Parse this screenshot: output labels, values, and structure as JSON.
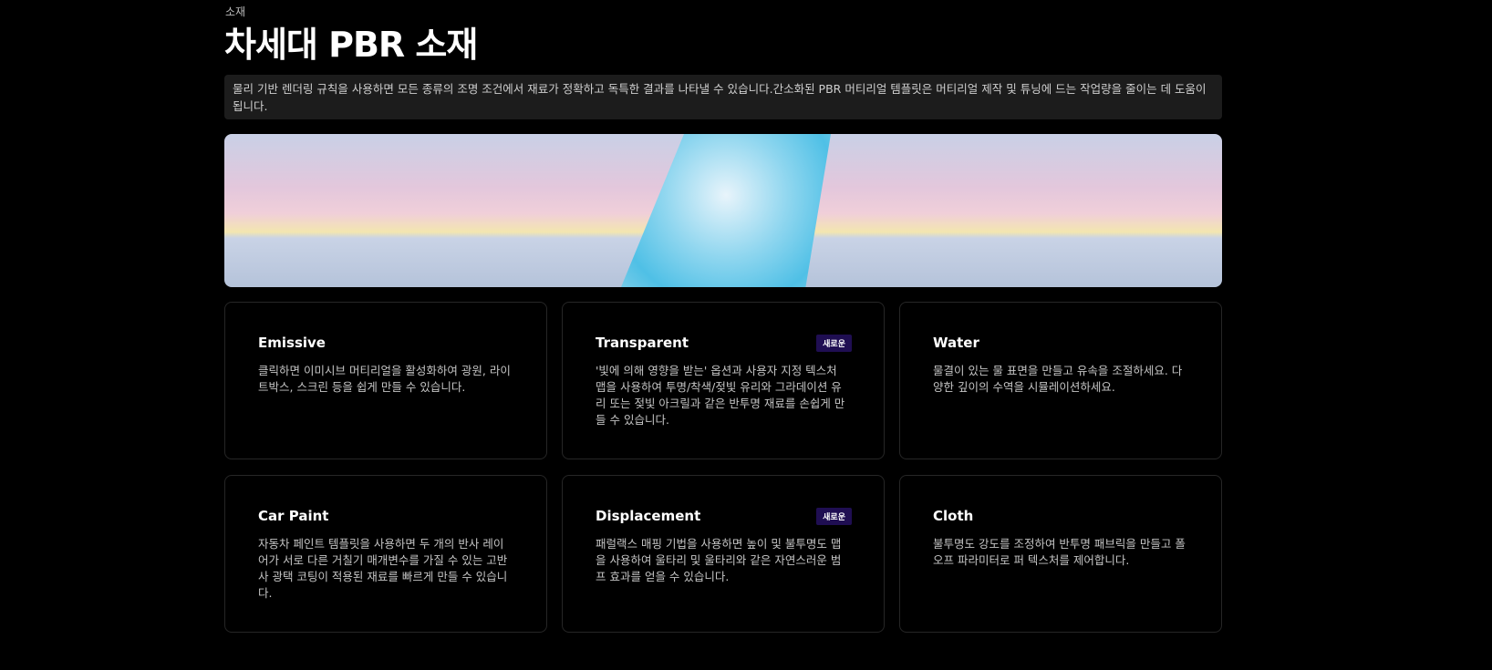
{
  "eyebrow": "소재",
  "title": "차세대 PBR 소재",
  "description": "물리 기반 렌더링 규칙을 사용하면 모든 종류의 조명 조건에서 재료가 정확하고 독특한 결과를 나타낼 수 있습니다.간소화된 PBR 머티리얼 템플릿은 머티리얼 제작 및 튜닝에 드는 작업량을 줄이는 데 도움이 됩니다.",
  "cards": [
    {
      "title": "Emissive",
      "text": "클릭하면 이미시브 머티리얼을 활성화하여 광원, 라이트박스, 스크린 등을 쉽게 만들 수 있습니다."
    },
    {
      "title": "Transparent",
      "badge": "새로운",
      "text": "'빛에 의해 영향을 받는' 옵션과 사용자 지정 텍스처 맵을 사용하여 투명/착색/젖빛 유리와 그라데이션 유리 또는 젖빛 아크릴과 같은 반투명 재료를 손쉽게 만들 수 있습니다."
    },
    {
      "title": "Water",
      "text": "물결이 있는 물 표면을 만들고 유속을 조절하세요. 다양한 깊이의 수역을 시뮬레이션하세요."
    },
    {
      "title": "Car Paint",
      "text": "자동차 페인트 템플릿을 사용하면 두 개의 반사 레이어가 서로 다른 거칠기 매개변수를 가질 수 있는 고반사 광택 코팅이 적용된 재료를 빠르게 만들 수 있습니다."
    },
    {
      "title": "Displacement",
      "badge": "새로운",
      "text": "패럴랙스 매핑 기법을 사용하면 높이 및 불투명도 맵을 사용하여 울타리 및 울타리와 같은 자연스러운 범프 효과를 얻을 수 있습니다."
    },
    {
      "title": "Cloth",
      "text": "불투명도 강도를 조정하여 반투명 패브릭을 만들고 폴오프 파라미터로 퍼 텍스처를 제어합니다."
    }
  ]
}
